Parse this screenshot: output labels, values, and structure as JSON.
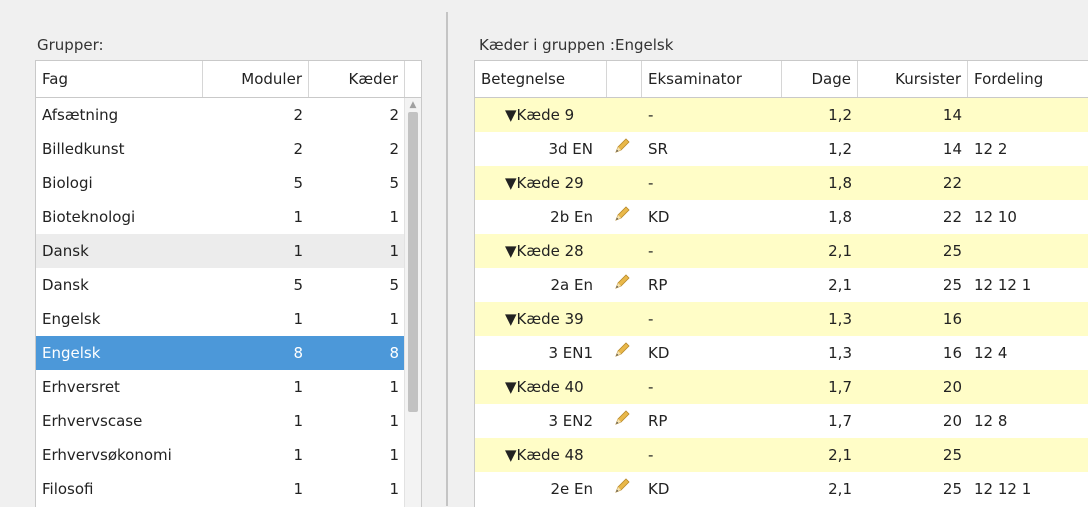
{
  "groups": {
    "label": "Grupper:",
    "columns": [
      "Fag",
      "Moduler",
      "Kæder"
    ],
    "rows": [
      {
        "fag": "Afsætning",
        "moduler": "2",
        "kaeder": "2"
      },
      {
        "fag": "Billedkunst",
        "moduler": "2",
        "kaeder": "2"
      },
      {
        "fag": "Biologi",
        "moduler": "5",
        "kaeder": "5"
      },
      {
        "fag": "Bioteknologi",
        "moduler": "1",
        "kaeder": "1"
      },
      {
        "fag": "Dansk",
        "moduler": "1",
        "kaeder": "1"
      },
      {
        "fag": "Dansk",
        "moduler": "5",
        "kaeder": "5"
      },
      {
        "fag": "Engelsk",
        "moduler": "1",
        "kaeder": "1"
      },
      {
        "fag": "Engelsk",
        "moduler": "8",
        "kaeder": "8"
      },
      {
        "fag": "Erhversret",
        "moduler": "1",
        "kaeder": "1"
      },
      {
        "fag": "Erhvervscase",
        "moduler": "1",
        "kaeder": "1"
      },
      {
        "fag": "Erhvervsøkonomi",
        "moduler": "1",
        "kaeder": "1"
      },
      {
        "fag": "Filosofi",
        "moduler": "1",
        "kaeder": "1"
      }
    ],
    "selected_index": 7,
    "hover_index": 4
  },
  "chains": {
    "label": "Kæder i gruppen :Engelsk",
    "columns": [
      "Betegnelse",
      "",
      "Eksaminator",
      "Dage",
      "Kursister",
      "Fordeling"
    ],
    "rows": [
      {
        "type": "chain",
        "betegnelse": "▼Kæde 9",
        "eksaminator": "-",
        "dage": "1,2",
        "kursister": "14",
        "fordeling": ""
      },
      {
        "type": "mod",
        "betegnelse": "3d EN",
        "eksaminator": "SR",
        "dage": "1,2",
        "kursister": "14",
        "fordeling": "12 2"
      },
      {
        "type": "chain",
        "betegnelse": "▼Kæde 29",
        "eksaminator": "-",
        "dage": "1,8",
        "kursister": "22",
        "fordeling": ""
      },
      {
        "type": "mod",
        "betegnelse": "2b En",
        "eksaminator": "KD",
        "dage": "1,8",
        "kursister": "22",
        "fordeling": "12 10"
      },
      {
        "type": "chain",
        "betegnelse": "▼Kæde 28",
        "eksaminator": "-",
        "dage": "2,1",
        "kursister": "25",
        "fordeling": ""
      },
      {
        "type": "mod",
        "betegnelse": "2a En",
        "eksaminator": "RP",
        "dage": "2,1",
        "kursister": "25",
        "fordeling": "12 12 1"
      },
      {
        "type": "chain",
        "betegnelse": "▼Kæde 39",
        "eksaminator": "-",
        "dage": "1,3",
        "kursister": "16",
        "fordeling": ""
      },
      {
        "type": "mod",
        "betegnelse": "3 EN1",
        "eksaminator": "KD",
        "dage": "1,3",
        "kursister": "16",
        "fordeling": "12 4"
      },
      {
        "type": "chain",
        "betegnelse": "▼Kæde 40",
        "eksaminator": "-",
        "dage": "1,7",
        "kursister": "20",
        "fordeling": ""
      },
      {
        "type": "mod",
        "betegnelse": "3 EN2",
        "eksaminator": "RP",
        "dage": "1,7",
        "kursister": "20",
        "fordeling": "12 8"
      },
      {
        "type": "chain",
        "betegnelse": "▼Kæde 48",
        "eksaminator": "-",
        "dage": "2,1",
        "kursister": "25",
        "fordeling": ""
      },
      {
        "type": "mod",
        "betegnelse": "2e En",
        "eksaminator": "KD",
        "dage": "2,1",
        "kursister": "25",
        "fordeling": "12 12 1"
      }
    ]
  },
  "colors": {
    "selected_row": "#4c98d9",
    "chain_row": "#fffdc7",
    "pencil": "#e9b84a"
  },
  "icons": {
    "edit": "pencil-icon",
    "scroll_up": "scroll-up-arrow-icon"
  }
}
